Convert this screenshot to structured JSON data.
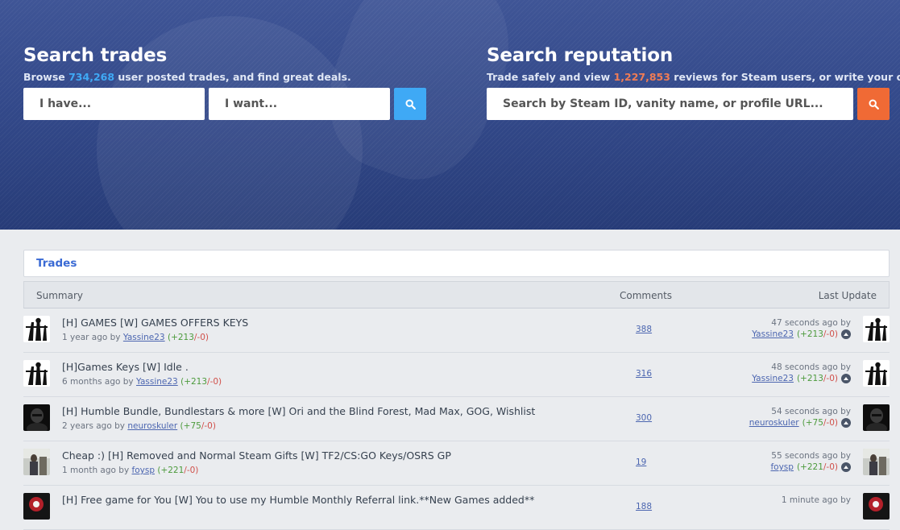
{
  "trades_search": {
    "title": "Search trades",
    "sub_prefix": "Browse ",
    "count": "734,268",
    "sub_suffix": " user posted trades, and find great deals.",
    "have_placeholder": "I have...",
    "want_placeholder": "I want...",
    "button_icon": "search-icon"
  },
  "reputation_search": {
    "title": "Search reputation",
    "sub_prefix": "Trade safely and view ",
    "count": "1,227,853",
    "sub_suffix": " reviews for Steam users, or write your own.",
    "placeholder": "Search by Steam ID, vanity name, or profile URL...",
    "button_icon": "search-icon"
  },
  "trades_box": {
    "label": "Trades"
  },
  "table": {
    "columns": [
      "Summary",
      "Comments",
      "Last Update"
    ],
    "rows": [
      {
        "title": "[H] GAMES [W] GAMES OFFERS KEYS",
        "age": "1 year ago by",
        "user": "Yassine23",
        "rep_pos": "(+213",
        "rep_neg": "/-0)",
        "comments": "388",
        "upd_time": "47 seconds ago by",
        "upd_user": "Yassine23",
        "upd_pos": "(+213",
        "upd_neg": "/-0)"
      },
      {
        "title": "[H]Games Keys [W] Idle .",
        "age": "6 months ago by",
        "user": "Yassine23",
        "rep_pos": "(+213",
        "rep_neg": "/-0)",
        "comments": "316",
        "upd_time": "48 seconds ago by",
        "upd_user": "Yassine23",
        "upd_pos": "(+213",
        "upd_neg": "/-0)"
      },
      {
        "title": "[H] Humble Bundle, Bundlestars & more [W] Ori and the Blind Forest, Mad Max, GOG, Wishlist",
        "age": "2 years ago by",
        "user": "neuroskuler",
        "rep_pos": "(+75",
        "rep_neg": "/-0)",
        "comments": "300",
        "upd_time": "54 seconds ago by",
        "upd_user": "neuroskuler",
        "upd_pos": "(+75",
        "upd_neg": "/-0)"
      },
      {
        "title": "Cheap :) [H] Removed and Normal Steam Gifts [W] TF2/CS:GO Keys/OSRS GP",
        "age": "1 month ago by",
        "user": "foysp",
        "rep_pos": "(+221",
        "rep_neg": "/-0)",
        "comments": "19",
        "upd_time": "55 seconds ago by",
        "upd_user": "foysp",
        "upd_pos": "(+221",
        "upd_neg": "/-0)"
      },
      {
        "title": "[H] Free game for You [W] You to use my Humble Monthly Referral link.**New Games added**",
        "age": "",
        "user": "",
        "rep_pos": "",
        "rep_neg": "",
        "comments": "188",
        "upd_time": "1 minute ago by",
        "upd_user": "",
        "upd_pos": "",
        "upd_neg": ""
      }
    ]
  },
  "colors": {
    "hero": "#33498a",
    "blue_btn": "#3fa9f5",
    "orange_btn": "#f06a35",
    "link": "#4c66b0"
  }
}
